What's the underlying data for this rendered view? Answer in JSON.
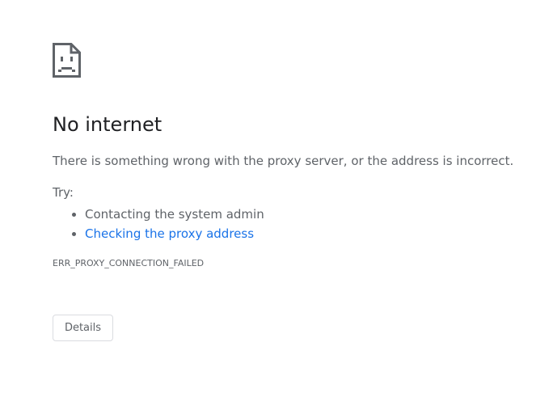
{
  "error": {
    "icon": "sad-page-icon",
    "title": "No internet",
    "message": "There is something wrong with the proxy server, or the address is incorrect.",
    "try_label": "Try:",
    "suggestions": [
      {
        "text": "Contacting the system admin",
        "is_link": false
      },
      {
        "text": "Checking the proxy address",
        "is_link": true
      }
    ],
    "code": "ERR_PROXY_CONNECTION_FAILED",
    "details_label": "Details"
  },
  "colors": {
    "title": "#202124",
    "text": "#5f6368",
    "link": "#1a73e8",
    "button_border": "#dadce0"
  }
}
